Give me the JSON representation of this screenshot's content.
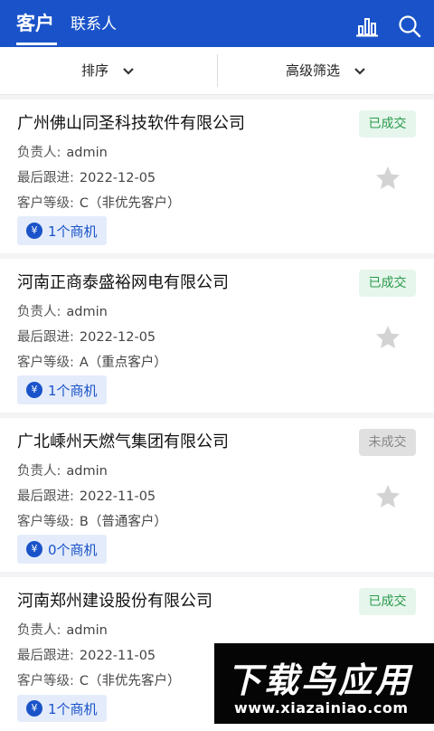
{
  "header": {
    "tabs": [
      {
        "label": "客户",
        "active": true
      },
      {
        "label": "联系人",
        "active": false
      }
    ],
    "icons": [
      "bar-chart-icon",
      "search-icon"
    ],
    "accent_color": "#1a53c9"
  },
  "filters": {
    "sort_label": "排序",
    "advanced_label": "高级筛选"
  },
  "labels": {
    "owner": "负责人:",
    "last_follow": "最后跟进:",
    "level": "客户等级:"
  },
  "customers": [
    {
      "name": "广州佛山同圣科技软件有限公司",
      "status": "已成交",
      "status_type": "done",
      "owner": "admin",
      "last_follow": "2022-12-05",
      "level": "C（非优先客户）",
      "opportunities": "1个商机"
    },
    {
      "name": "河南正商泰盛裕网电有限公司",
      "status": "已成交",
      "status_type": "done",
      "owner": "admin",
      "last_follow": "2022-12-05",
      "level": "A（重点客户）",
      "opportunities": "1个商机"
    },
    {
      "name": "广北嵊州天燃气集团有限公司",
      "status": "未成交",
      "status_type": "undone",
      "owner": "admin",
      "last_follow": "2022-11-05",
      "level": "B（普通客户）",
      "opportunities": "0个商机"
    },
    {
      "name": "河南郑州建设股份有限公司",
      "status": "已成交",
      "status_type": "done",
      "owner": "admin",
      "last_follow": "2022-11-05",
      "level": "C（非优先客户）",
      "opportunities": "1个商机"
    }
  ],
  "opportunity_icon_glyph": "¥",
  "watermark": {
    "title": "下载鸟应用",
    "url": "www.xiazainiao.com"
  }
}
